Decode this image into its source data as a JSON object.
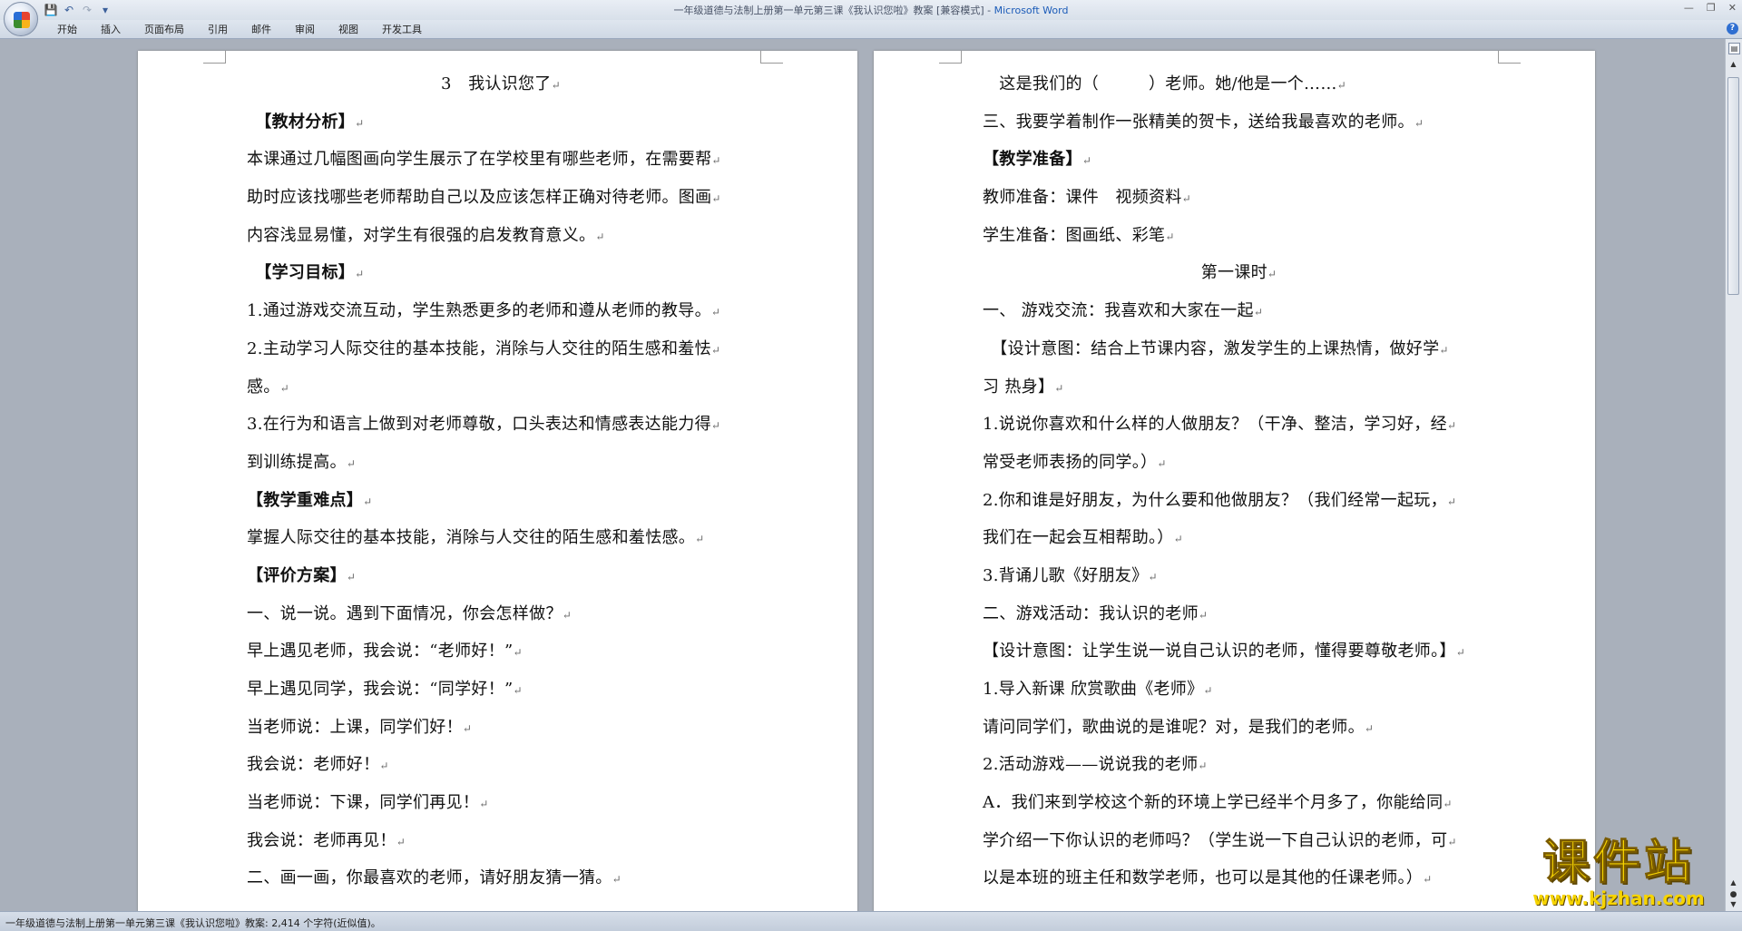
{
  "window": {
    "doc_title": "一年级道德与法制上册第一单元第三课《我认识您啦》教案 [兼容模式]",
    "app_name": "Microsoft Word"
  },
  "quick_access": [
    {
      "name": "save-icon",
      "glyph": "💾"
    },
    {
      "name": "undo-icon",
      "glyph": "↶"
    },
    {
      "name": "redo-icon",
      "glyph": "↷"
    },
    {
      "name": "customize-icon",
      "glyph": "▾"
    }
  ],
  "ribbon": {
    "tabs": [
      "开始",
      "插入",
      "页面布局",
      "引用",
      "邮件",
      "审阅",
      "视图",
      "开发工具"
    ]
  },
  "pages": [
    {
      "lines": [
        {
          "t": "3　我认识您了",
          "center": true
        },
        {
          "t": "　【教材分析】",
          "bold": true
        },
        {
          "t": "本课通过几幅图画向学生展示了在学校里有哪些老师，在需要帮"
        },
        {
          "t": "助时应该找哪些老师帮助自己以及应该怎样正确对待老师。图画"
        },
        {
          "t": "内容浅显易懂，对学生有很强的启发教育意义。"
        },
        {
          "t": "　【学习目标】",
          "bold": true
        },
        {
          "t": "1.通过游戏交流互动，学生熟悉更多的老师和遵从老师的教导。"
        },
        {
          "t": "2.主动学习人际交往的基本技能，消除与人交往的陌生感和羞怯"
        },
        {
          "t": "感。"
        },
        {
          "t": "3.在行为和语言上做到对老师尊敬，口头表达和情感表达能力得"
        },
        {
          "t": "到训练提高。"
        },
        {
          "t": "【教学重难点】",
          "bold": true
        },
        {
          "t": " 掌握人际交往的基本技能，消除与人交往的陌生感和羞怯感。"
        },
        {
          "t": "【评价方案】",
          "bold": true
        },
        {
          "t": "一、说一说。遇到下面情况，你会怎样做？"
        },
        {
          "t": "早上遇见老师，我会说：“老师好！”"
        },
        {
          "t": "早上遇见同学，我会说：“同学好！”"
        },
        {
          "t": "当老师说：上课，同学们好！"
        },
        {
          "t": "我会说：老师好！"
        },
        {
          "t": "当老师说：下课，同学们再见！"
        },
        {
          "t": "我会说：老师再见！"
        },
        {
          "t": "二、画一画，你最喜欢的老师，请好朋友猜一猜。"
        }
      ]
    },
    {
      "lines": [
        {
          "t": "　这是我们的（　　　）老师。她/他是一个……"
        },
        {
          "t": "三、我要学着制作一张精美的贺卡，送给我最喜欢的老师。"
        },
        {
          "t": "【教学准备】",
          "bold": true
        },
        {
          "t": "教师准备：课件　视频资料"
        },
        {
          "t": "学生准备：图画纸、彩笔"
        },
        {
          "t": "第一课时",
          "center": true
        },
        {
          "t": "一、 游戏交流：我喜欢和大家在一起"
        },
        {
          "t": "　【设计意图：结合上节课内容，激发学生的上课热情，做好学"
        },
        {
          "t": "习 热身】"
        },
        {
          "t": "1.说说你喜欢和什么样的人做朋友？（干净、整洁，学习好，经"
        },
        {
          "t": "常受老师表扬的同学。）"
        },
        {
          "t": "2.你和谁是好朋友，为什么要和他做朋友？（我们经常一起玩，"
        },
        {
          "t": "我们在一起会互相帮助。）"
        },
        {
          "t": "3.背诵儿歌《好朋友》"
        },
        {
          "t": "二、游戏活动：我认识的老师"
        },
        {
          "t": "【设计意图：让学生说一说自己认识的老师，懂得要尊敬老师。】"
        },
        {
          "t": "1.导入新课 欣赏歌曲《老师》"
        },
        {
          "t": "请问同学们，歌曲说的是谁呢？对，是我们的老师。"
        },
        {
          "t": "2.活动游戏——说说我的老师"
        },
        {
          "t": "A．我们来到学校这个新的环境上学已经半个月多了，你能给同"
        },
        {
          "t": "学介绍一下你认识的老师吗？（学生说一下自己认识的老师，可"
        },
        {
          "t": "以是本班的班主任和数学老师，也可以是其他的任课老师。）"
        }
      ]
    }
  ],
  "paragraph_mark": "↵",
  "status": {
    "text": "一年级道德与法制上册第一单元第三课《我认识您啦》教案: 2,414 个字符(近似值)。"
  },
  "watermark": {
    "main": "课件站",
    "sub": "www.kjzhan.com"
  }
}
